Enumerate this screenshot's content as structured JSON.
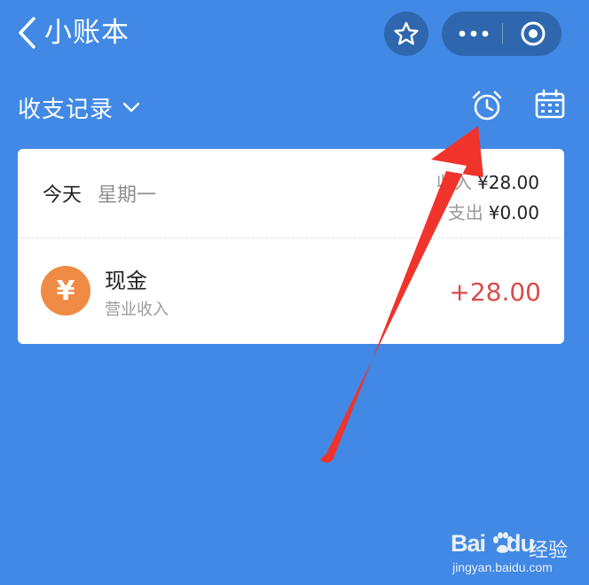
{
  "nav": {
    "title": "小账本",
    "icons": {
      "back": "chevron-left-icon",
      "favorite": "star-icon",
      "more": "more-dots-icon",
      "close": "target-circle-icon"
    }
  },
  "toolbar": {
    "filter_label": "收支记录",
    "icons": {
      "filter": "chevron-down-icon",
      "reminder": "alarm-clock-icon",
      "calendar": "calendar-icon"
    }
  },
  "summary": {
    "day_label": "今天",
    "weekday": "星期一",
    "income_label": "收入",
    "income_value": "¥28.00",
    "expense_label": "支出",
    "expense_value": "¥0.00"
  },
  "entries": [
    {
      "icon": "yen-icon",
      "icon_glyph": "¥",
      "icon_color": "#ef8b44",
      "name": "现金",
      "category": "营业收入",
      "amount": "+28.00"
    }
  ],
  "colors": {
    "background": "#4189e4",
    "capsule": "#2f67ae",
    "income_amount": "#d94a4a",
    "annotation_arrow": "#f0332b"
  },
  "watermark": {
    "logo_bai": "Bai",
    "logo_du": "du",
    "suffix": "经验",
    "url": "jingyan.baidu.com"
  }
}
